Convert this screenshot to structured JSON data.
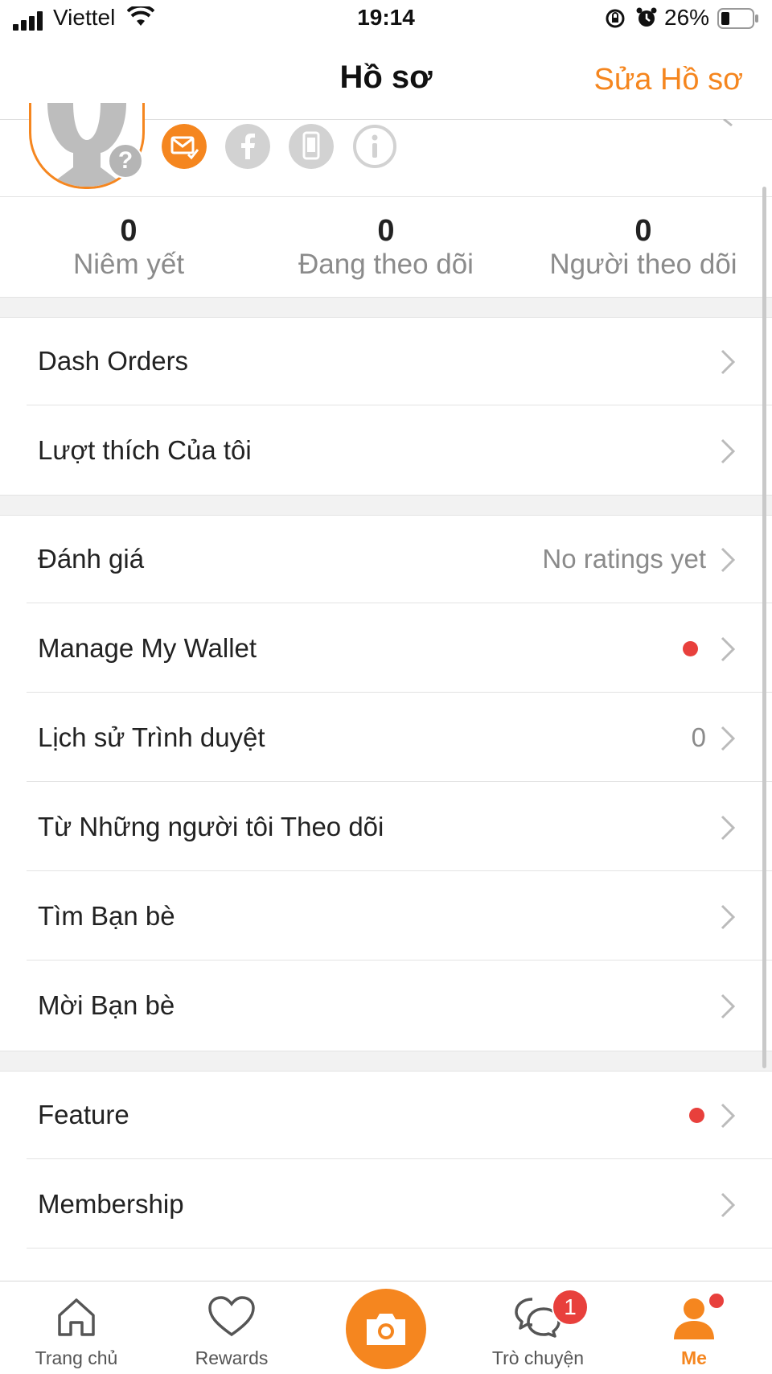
{
  "status_bar": {
    "carrier": "Viettel",
    "time": "19:14",
    "battery": "26%",
    "icons": [
      "signal-icon",
      "wifi-icon",
      "orientation-lock-icon",
      "alarm-icon",
      "battery-icon"
    ]
  },
  "header": {
    "title": "Hồ sơ",
    "edit_label": "Sửa Hồ sơ"
  },
  "profile": {
    "verification_icons": [
      "email-verified-icon",
      "facebook-icon",
      "phone-icon",
      "info-icon"
    ],
    "avatar_badge": "?"
  },
  "stats": [
    {
      "value": "0",
      "label": "Niêm yết"
    },
    {
      "value": "0",
      "label": "Đang theo dõi"
    },
    {
      "value": "0",
      "label": "Người theo dõi"
    }
  ],
  "menu": {
    "section1": [
      {
        "label": "Dash Orders"
      },
      {
        "label": "Lượt thích Của tôi"
      }
    ],
    "section2": [
      {
        "label": "Đánh giá",
        "value": "No ratings yet"
      },
      {
        "label": "Manage My Wallet",
        "dot": true
      },
      {
        "label": "Lịch sử Trình duyệt",
        "value": "0"
      },
      {
        "label": "Từ Những người tôi Theo dõi"
      },
      {
        "label": "Tìm Bạn bè"
      },
      {
        "label": "Mời Bạn bè"
      }
    ],
    "section3": [
      {
        "label": "Feature",
        "dot": true
      },
      {
        "label": "Membership"
      }
    ]
  },
  "tabbar": {
    "tabs": [
      {
        "label": "Trang chủ",
        "icon": "home-icon"
      },
      {
        "label": "Rewards",
        "icon": "heart-icon"
      },
      {
        "label": "",
        "icon": "camera-icon"
      },
      {
        "label": "Trò chuyện",
        "icon": "chat-icon",
        "badge": "1"
      },
      {
        "label": "Me",
        "icon": "person-icon",
        "active": true
      }
    ]
  },
  "colors": {
    "accent": "#f5861f",
    "badge_red": "#e8403c",
    "muted_text": "#8b8b8b"
  }
}
